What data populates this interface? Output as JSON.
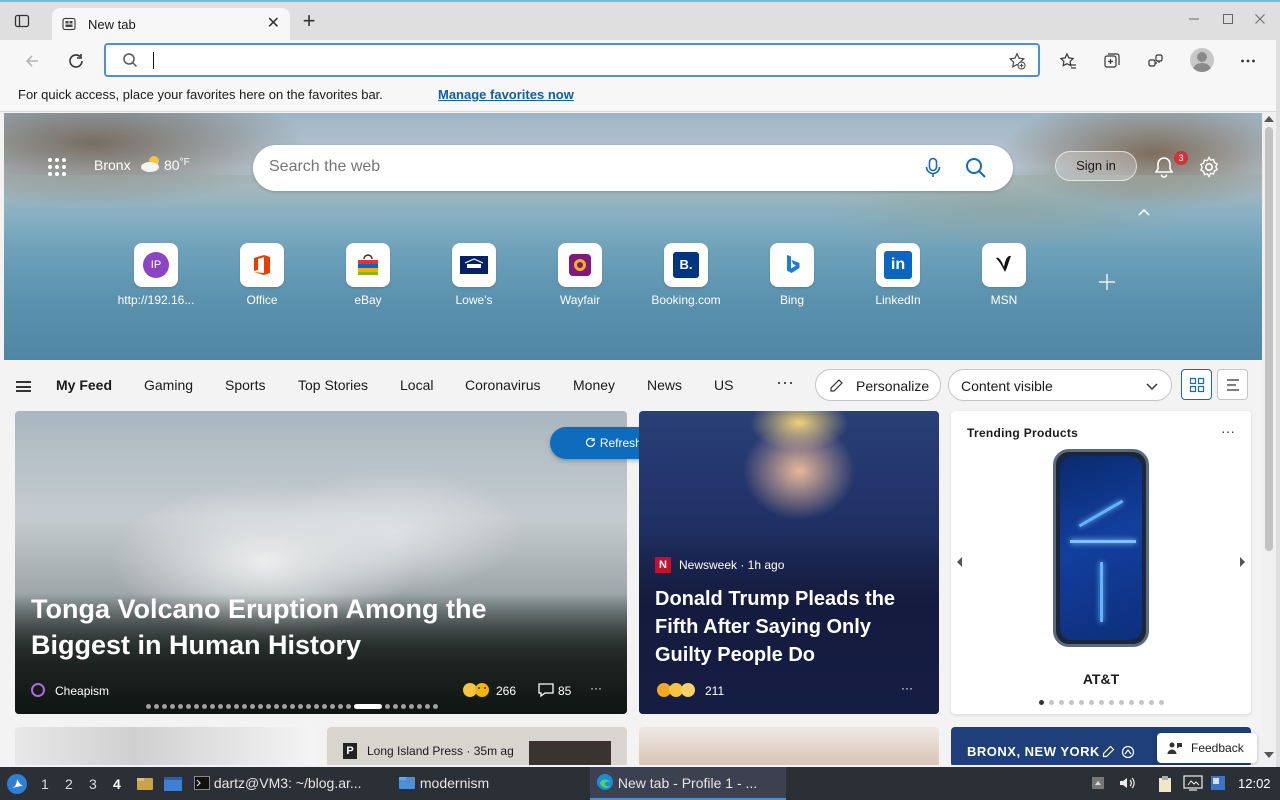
{
  "browser": {
    "tab_title": "New tab",
    "tab_close": "✕",
    "new_tab": "+",
    "address_value": "",
    "favorites_message": "For quick access, place your favorites here on the favorites bar.",
    "favorites_link": "Manage favorites now"
  },
  "hero": {
    "city": "Bronx",
    "temperature": "80",
    "temperature_unit": "°F",
    "search_placeholder": "Search the web",
    "sign_in": "Sign in",
    "notification_count": "3",
    "tiles": [
      {
        "label": "http://192.16...",
        "icon": "ip-icon"
      },
      {
        "label": "Office",
        "icon": "office-icon"
      },
      {
        "label": "eBay",
        "icon": "ebay-icon"
      },
      {
        "label": "Lowe's",
        "icon": "lowes-icon"
      },
      {
        "label": "Wayfair",
        "icon": "wayfair-icon"
      },
      {
        "label": "Booking.com",
        "icon": "booking-icon"
      },
      {
        "label": "Bing",
        "icon": "bing-icon"
      },
      {
        "label": "LinkedIn",
        "icon": "linkedin-icon"
      },
      {
        "label": "MSN",
        "icon": "msn-icon"
      }
    ],
    "ip_tile_text": "IP",
    "booking_tile_text": "B.",
    "linkedin_tile_text": "in"
  },
  "feed_nav": {
    "tabs": [
      "My Feed",
      "Gaming",
      "Sports",
      "Top Stories",
      "Local",
      "Coronavirus",
      "Money",
      "News",
      "US"
    ],
    "more": "···",
    "personalize": "Personalize",
    "content_visibility": "Content visible"
  },
  "cards": {
    "main": {
      "headline": "Tonga Volcano Eruption Among the Biggest in Human History",
      "source": "Cheapism",
      "likes": "266",
      "comments": "85",
      "more": "···",
      "slide_count": 34,
      "active_slide": 26
    },
    "refresh": "Refresh stories",
    "news": {
      "logo": "N",
      "meta": "Newsweek · 1h ago",
      "headline": "Donald Trump Pleads the Fifth After Saying Only Guilty People Do",
      "reactions": "211",
      "more": "···"
    },
    "trending": {
      "title": "Trending Products",
      "more": "···",
      "brand": "AT&T",
      "dot_count": 13,
      "active_dot": 0
    },
    "small_2": {
      "logo": "P",
      "meta": "Long Island Press · 35m ag"
    },
    "small_4": {
      "location": "BRONX, NEW YORK"
    },
    "feedback": "Feedback"
  },
  "taskbar": {
    "workspaces": [
      "1",
      "2",
      "3",
      "4"
    ],
    "current_workspace": "4",
    "terminal": "dartz@VM3: ~/blog.ar...",
    "folder": "modernism",
    "browser": "New tab - Profile 1 - ...",
    "clock": "12:02"
  },
  "colors": {
    "accent": "#0f6cbd",
    "link": "#0f5ea8",
    "badge": "#d13438",
    "taskbar": "#2b2f36"
  }
}
